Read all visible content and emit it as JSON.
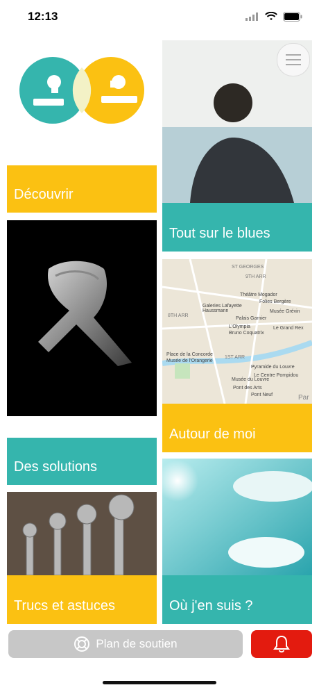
{
  "status_bar": {
    "time": "12:13"
  },
  "colors": {
    "yellow": "#fbc112",
    "teal": "#35b5ad",
    "red": "#e31b0f",
    "gray_button": "#c7c7c7"
  },
  "tiles": {
    "decouvrir": "Découvrir",
    "tout_sur_le_blues": "Tout sur le blues",
    "des_solutions": "Des solutions",
    "autour_de_moi": "Autour de moi",
    "trucs_et_astuces": "Trucs et astuces",
    "ou_jen_suis": "Où j'en suis ?"
  },
  "map_labels": [
    "ST GEORGES",
    "9TH ARR",
    "Théâtre Mogador",
    "Folies Bergère",
    "Galeries Lafayette Haussmann",
    "Musée Grévin",
    "Palais Garnier",
    "8TH ARR",
    "L'Olympia",
    "Bruno Coquatrix",
    "Le Grand Rex",
    "Place de la Concorde",
    "Musée de l'Orangerie",
    "1ST ARR",
    "Pyramide du Louvre",
    "Le Centre Pompidou",
    "Musée du Louvre",
    "Pont des Arts",
    "Pont Neuf",
    "Par"
  ],
  "bottom_bar": {
    "support_label": "Plan de soutien",
    "lifebuoy_icon": "lifebuoy-icon",
    "bell_icon": "bell-icon"
  },
  "menu_icon": "hamburger-menu-icon"
}
